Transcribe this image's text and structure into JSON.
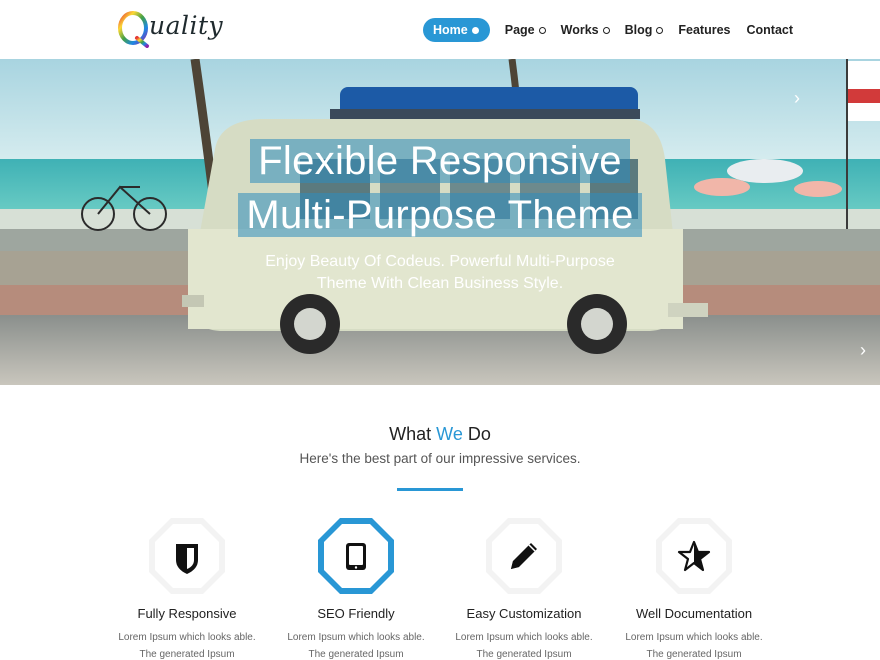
{
  "brand": {
    "logo_text": "uality",
    "logo_letter": "Q"
  },
  "nav": {
    "items": [
      {
        "label": "Home",
        "active": true,
        "has_dropdown": true
      },
      {
        "label": "Page",
        "active": false,
        "has_dropdown": true
      },
      {
        "label": "Works",
        "active": false,
        "has_dropdown": true
      },
      {
        "label": "Blog",
        "active": false,
        "has_dropdown": true
      },
      {
        "label": "Features",
        "active": false,
        "has_dropdown": false
      },
      {
        "label": "Contact",
        "active": false,
        "has_dropdown": false
      }
    ]
  },
  "hero": {
    "title_line1": "Flexible Responsive",
    "title_line2": "Multi-Purpose Theme",
    "subtitle": "Enjoy Beauty Of Codeus. Powerful Multi-Purpose Theme With Clean Business Style.",
    "next_arrow": "›"
  },
  "services": {
    "title_part1": "What",
    "title_accent": "We",
    "title_part2": "Do",
    "subtitle": "Here's the best part of our impressive services.",
    "items": [
      {
        "title": "Fully Responsive",
        "icon": "shield-icon",
        "text": "Lorem Ipsum which looks able. The generated Ipsum",
        "highlighted": false
      },
      {
        "title": "SEO Friendly",
        "icon": "tablet-icon",
        "text": "Lorem Ipsum which looks able. The generated Ipsum",
        "highlighted": true
      },
      {
        "title": "Easy Customization",
        "icon": "pencil-icon",
        "text": "Lorem Ipsum which looks able. The generated Ipsum",
        "highlighted": false
      },
      {
        "title": "Well Documentation",
        "icon": "star-icon",
        "text": "Lorem Ipsum which looks able. The generated Ipsum",
        "highlighted": false
      }
    ]
  },
  "colors": {
    "accent": "#2997d5",
    "text_dark": "#222222",
    "text_muted": "#666666"
  }
}
